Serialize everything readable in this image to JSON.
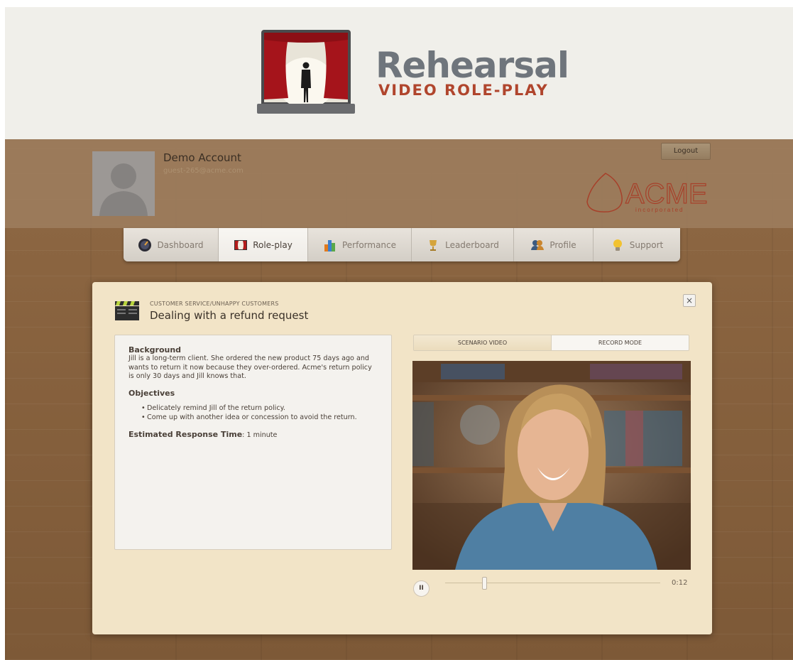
{
  "brand": {
    "title": "Rehearsal",
    "subtitle": "VIDEO ROLE-PLAY"
  },
  "account": {
    "name": "Demo Account",
    "email": "guest-265@acme.com",
    "logout_label": "Logout",
    "company_logo_text": "ACME",
    "company_logo_subtext": "incorporated"
  },
  "nav": {
    "items": [
      {
        "label": "Dashboard",
        "icon": "dashboard-gauge-icon",
        "active": false
      },
      {
        "label": "Role-play",
        "icon": "theater-stage-icon",
        "active": true
      },
      {
        "label": "Performance",
        "icon": "bar-chart-icon",
        "active": false
      },
      {
        "label": "Leaderboard",
        "icon": "trophy-icon",
        "active": false
      },
      {
        "label": "Profile",
        "icon": "people-icon",
        "active": false
      },
      {
        "label": "Support",
        "icon": "lightbulb-icon",
        "active": false
      }
    ]
  },
  "scenario": {
    "category": "CUSTOMER SERVICE/UNHAPPY CUSTOMERS",
    "title": "Dealing with a refund request",
    "close_label": "×",
    "background_heading": "Background",
    "background_text": "Jill is a long-term client. She ordered the new product 75 days ago and wants to return it now because they over-ordered. Acme's return policy is only 30 days and Jill knows that.",
    "objectives_heading": "Objectives",
    "objectives": [
      "Delicately remind Jill of the return policy.",
      "Come up with another idea or concession to avoid the return."
    ],
    "estimated_label": "Estimated Response Time",
    "estimated_value": ": 1 minute"
  },
  "video": {
    "tabs": [
      {
        "label": "SCENARIO VIDEO",
        "active": true
      },
      {
        "label": "RECORD MODE",
        "active": false
      }
    ],
    "play_pause_label": "II",
    "time": "0:12",
    "progress_fraction": 0.18
  },
  "colors": {
    "accent_red": "#b0452d",
    "title_gray": "#6f757c",
    "modal_bg": "#f2e4c7"
  }
}
